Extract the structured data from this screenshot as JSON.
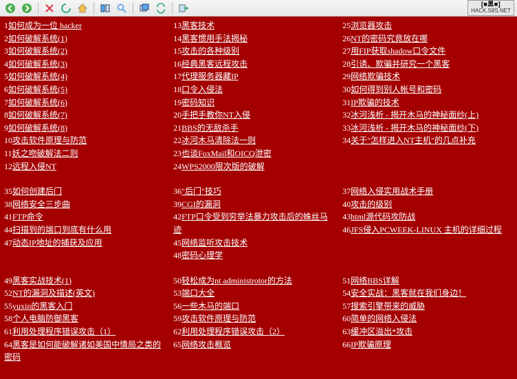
{
  "toolbar": {
    "back": "后退",
    "forward": "前进",
    "stop": "停止",
    "refresh": "刷新",
    "home": "主页",
    "panels": "面板",
    "search": "搜索",
    "tabs": "标签",
    "sync": "同步",
    "go": "转到"
  },
  "logo": {
    "line1": "[■黑■]",
    "line2": "HACK.S8S.NET"
  },
  "columns_block1": [
    [
      {
        "n": "1",
        "t": "如何成为一位 hacker"
      },
      {
        "n": "2",
        "t": "如何破解系统(1)"
      },
      {
        "n": "3",
        "t": "如何破解系统(2)"
      },
      {
        "n": "4",
        "t": "如何破解系统(3)"
      },
      {
        "n": "5",
        "t": "如何破解系统(4)"
      },
      {
        "n": "6",
        "t": "如何破解系统(5)"
      },
      {
        "n": "7",
        "t": "如何破解系统(6)"
      },
      {
        "n": "8",
        "t": "如何破解系统(7)"
      },
      {
        "n": "9",
        "t": "如何破解系统(8)"
      },
      {
        "n": "10",
        "t": "攻击软件原理与防范"
      },
      {
        "n": "11",
        "t": "妖之吻破解法二则"
      },
      {
        "n": "12",
        "t": "远程入侵NT"
      }
    ],
    [
      {
        "n": "13",
        "t": "黑客技术"
      },
      {
        "n": "14",
        "t": "黑客惯用手法揭秘"
      },
      {
        "n": "15",
        "t": "攻击的各种级别"
      },
      {
        "n": "16",
        "t": "经典黑客远程攻击"
      },
      {
        "n": "17",
        "t": "代理服务器藏IP"
      },
      {
        "n": "18",
        "t": "口令入侵法"
      },
      {
        "n": "19",
        "t": "密码知识"
      },
      {
        "n": "20",
        "t": "手把手教你NT入侵"
      },
      {
        "n": "21",
        "t": "BBS的无敌杀手"
      },
      {
        "n": "22",
        "t": "冰河木马清除法一则"
      },
      {
        "n": "23",
        "t": "也谈FoxMail和OICQ泄密"
      },
      {
        "n": "24",
        "t": "WPS2000限次版的破解"
      }
    ],
    [
      {
        "n": "25",
        "t": "浏览器攻击"
      },
      {
        "n": "26",
        "t": "NT的密码究竟放在哪"
      },
      {
        "n": "27",
        "t": "用FIP获取shadow口令文件"
      },
      {
        "n": "28",
        "t": "引诱、欺骗并研究一个黑客"
      },
      {
        "n": "29",
        "t": "网络欺骗技术"
      },
      {
        "n": "30",
        "t": "如何得到别人帐号和密码"
      },
      {
        "n": "31",
        "t": "IP欺骗的技术"
      },
      {
        "n": "32",
        "t": "冰河浅析 - 揭开木马的神秘面纱(上)"
      },
      {
        "n": "33",
        "t": "冰河浅析 - 揭开木马的神秘面纱(下)"
      },
      {
        "n": "34",
        "t": "关于\"怎样进入NT主机\"的几点补充"
      }
    ]
  ],
  "columns_block2": [
    [
      {
        "n": "35",
        "t": "如何创建后门"
      },
      {
        "n": "38",
        "t": "网络安全三步曲"
      },
      {
        "n": "41",
        "t": "FTP命令"
      },
      {
        "n": "44",
        "t": "扫描到的端口到底有什么用"
      },
      {
        "n": "47",
        "t": "动态IP地址的捕获及应用"
      }
    ],
    [
      {
        "n": "36",
        "t": "\"后门\"技巧"
      },
      {
        "n": "39",
        "t": "CGI的漏洞"
      },
      {
        "n": "42",
        "t": "FTP口令受到穷举法暴力攻击后的蛛丝马迹"
      },
      {
        "n": "45",
        "t": "网络监听攻击技术"
      },
      {
        "n": "48",
        "t": "密码心理学"
      }
    ],
    [
      {
        "n": "37",
        "t": "网络入侵实用战术手册"
      },
      {
        "n": "40",
        "t": "攻击的级别"
      },
      {
        "n": "43",
        "t": "html源代码攻防战"
      },
      {
        "n": "46",
        "t": "JFS侵入PCWEEK-LINUX 主机的详细过程"
      }
    ]
  ],
  "columns_block3": [
    [
      {
        "n": "49",
        "t": "黑客实战技术(1)"
      },
      {
        "n": "52",
        "t": "NT的漏洞及描述(英文)"
      },
      {
        "n": "55",
        "t": "yuxin的黑客入门"
      },
      {
        "n": "58",
        "t": "个人电脑防御黑客"
      },
      {
        "n": "61",
        "t": "利用处理程序错误攻击（1）"
      },
      {
        "n": "64",
        "t": "黑客是如何能破解诸如美国中情局之类的密码"
      }
    ],
    [
      {
        "n": "50",
        "t": "轻松成为nt administrotor的方法"
      },
      {
        "n": "53",
        "t": "端口大全"
      },
      {
        "n": "56",
        "t": "一些木马的端口"
      },
      {
        "n": "59",
        "t": "攻击软件原理与防范"
      },
      {
        "n": "62",
        "t": "利用处理程序错误攻击（2）"
      },
      {
        "n": "65",
        "t": "网络攻击概览"
      }
    ],
    [
      {
        "n": "51",
        "t": "网络BBS详解"
      },
      {
        "n": "54",
        "t": "安全实战：黑客就在我们身边！"
      },
      {
        "n": "57",
        "t": "搜索引擎带来的威胁"
      },
      {
        "n": "60",
        "t": "简单的网络入侵法"
      },
      {
        "n": "63",
        "t": "缓冲区溢出*攻击"
      },
      {
        "n": "66",
        "t": "IP欺骗原理"
      }
    ]
  ]
}
